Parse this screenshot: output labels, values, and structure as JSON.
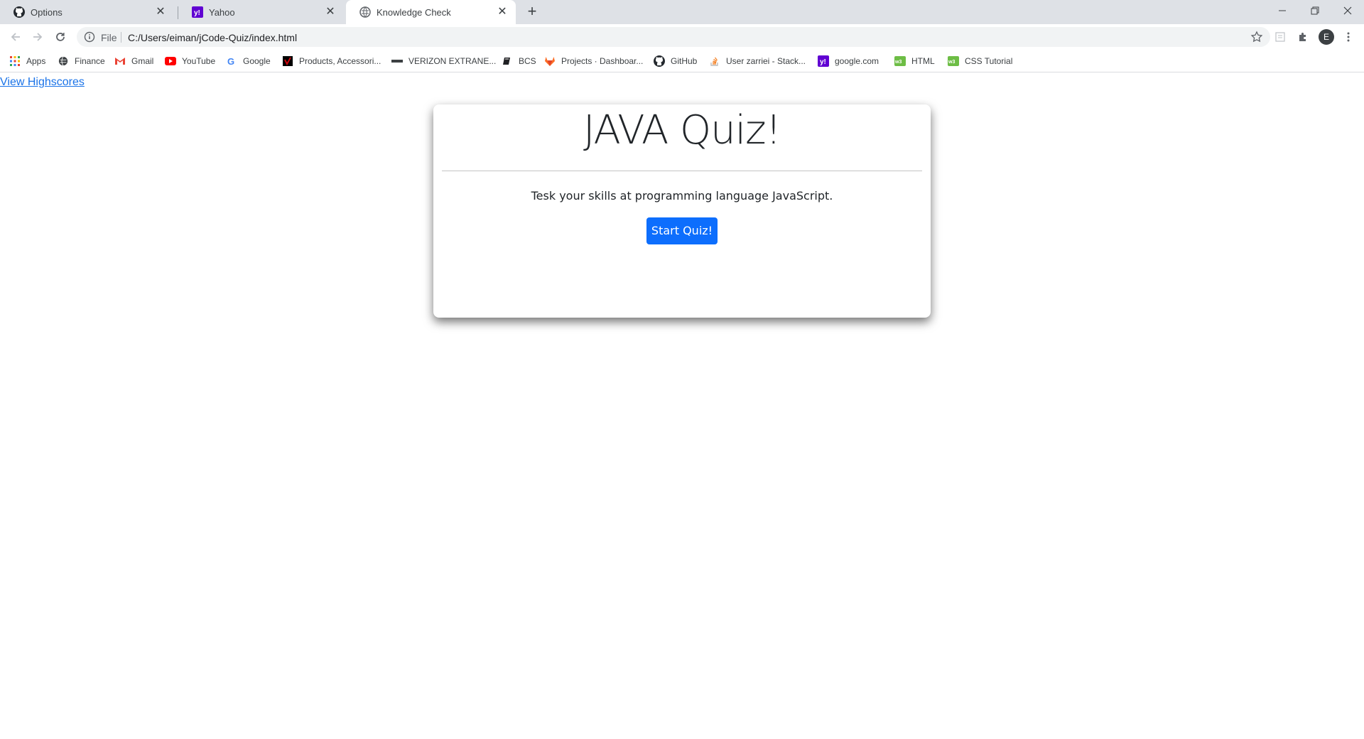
{
  "browser": {
    "tabs": [
      {
        "title": "Options",
        "icon": "github-icon"
      },
      {
        "title": "Yahoo",
        "icon": "yahoo-icon"
      },
      {
        "title": "Knowledge Check",
        "icon": "globe-icon"
      }
    ],
    "address_bar": {
      "scheme_label": "File",
      "url": "C:/Users/eiman/jCode-Quiz/index.html"
    },
    "profile_initial": "E",
    "bookmarks": [
      {
        "label": "Apps",
        "icon": "apps-grid-icon"
      },
      {
        "label": "Finance",
        "icon": "globe-icon"
      },
      {
        "label": "Gmail",
        "icon": "gmail-icon"
      },
      {
        "label": "YouTube",
        "icon": "youtube-icon"
      },
      {
        "label": "Google",
        "icon": "google-icon"
      },
      {
        "label": "Products, Accessori...",
        "icon": "verizon-icon"
      },
      {
        "label": "VERIZON EXTRANE...",
        "icon": "verizon-extranet-icon"
      },
      {
        "label": "BCS",
        "icon": "book-icon"
      },
      {
        "label": "Projects · Dashboar...",
        "icon": "gitlab-icon"
      },
      {
        "label": "GitHub",
        "icon": "github-icon"
      },
      {
        "label": "User zarriei - Stack...",
        "icon": "stackoverflow-icon"
      },
      {
        "label": "google.com",
        "icon": "yahoo-icon"
      },
      {
        "label": "HTML",
        "icon": "w3schools-icon"
      },
      {
        "label": "CSS Tutorial",
        "icon": "w3schools-icon"
      }
    ]
  },
  "page": {
    "highscores_link": "View Highscores",
    "quiz": {
      "title": "JAVA Quiz!",
      "subtitle": "Tesk your skills at programming language JavaScript.",
      "start_button": "Start Quiz!"
    }
  },
  "colors": {
    "accent": "#0d6efd",
    "link": "#1a73e8",
    "tabstrip": "#dee1e6"
  }
}
